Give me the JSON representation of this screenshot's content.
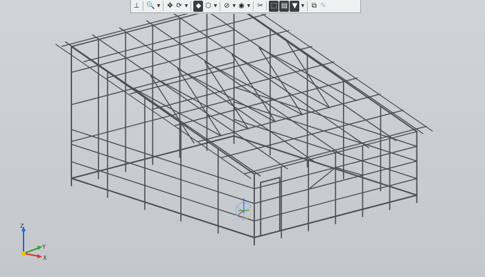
{
  "toolbar": {
    "buttons": [
      {
        "name": "coordinate-system-icon",
        "glyph": "⊥",
        "dark": false
      },
      {
        "name": "zoom-icon",
        "glyph": "🔍",
        "dark": false
      },
      {
        "name": "zoom-dropdown-icon",
        "glyph": "▼",
        "dd": true
      },
      {
        "name": "pan-icon",
        "glyph": "✥",
        "dark": false
      },
      {
        "name": "rotate-icon",
        "glyph": "⟳",
        "dark": false
      },
      {
        "name": "rotate-dropdown-icon",
        "glyph": "▼",
        "dd": true
      },
      {
        "name": "display-mode-icon",
        "glyph": "◆",
        "dark": true
      },
      {
        "name": "orientation-icon",
        "glyph": "⬡",
        "dark": false
      },
      {
        "name": "orientation-dropdown-icon",
        "glyph": "▼",
        "dd": true
      },
      {
        "name": "hide-icon",
        "glyph": "⊘",
        "dark": false
      },
      {
        "name": "hide-dropdown-icon",
        "glyph": "▼",
        "dd": true
      },
      {
        "name": "visibility-icon",
        "glyph": "◉",
        "dark": false
      },
      {
        "name": "visibility-dropdown-icon",
        "glyph": "▼",
        "dd": true
      },
      {
        "name": "section-icon",
        "glyph": "✂",
        "dark": false
      },
      {
        "name": "perspective-icon",
        "glyph": "⬚",
        "dark": true
      },
      {
        "name": "layers-icon",
        "glyph": "▤",
        "dark": true
      },
      {
        "name": "filter-icon",
        "glyph": "▼",
        "dark": true
      },
      {
        "name": "filter-dropdown-icon",
        "glyph": "▼",
        "dd": true
      },
      {
        "name": "select-frame-icon",
        "glyph": "⧉",
        "dark": false
      },
      {
        "name": "eyedropper-icon",
        "glyph": "✎",
        "disabled": true
      }
    ]
  },
  "triad": {
    "z_label": "Z",
    "y_label": "Y",
    "x_label": "X",
    "colors": {
      "x": "#e03030",
      "y": "#30a030",
      "z": "#3060d0",
      "origin": "#f0c000"
    }
  },
  "model_color": "#4a4d52"
}
